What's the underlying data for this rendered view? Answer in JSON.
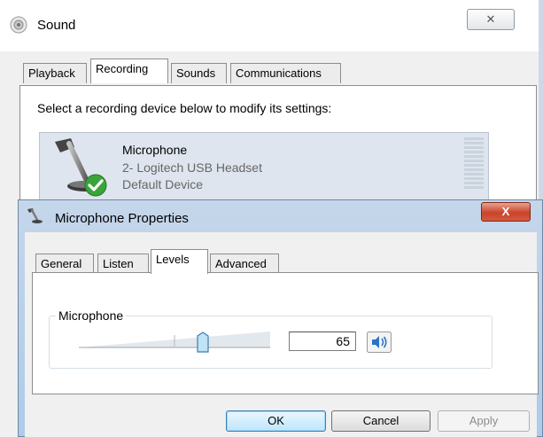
{
  "sound_window": {
    "title": "Sound",
    "close_glyph": "✕",
    "tabs": [
      {
        "label": "Playback"
      },
      {
        "label": "Recording"
      },
      {
        "label": "Sounds"
      },
      {
        "label": "Communications"
      }
    ],
    "active_tab": "Recording",
    "instruction": "Select a recording device below to modify its settings:",
    "device": {
      "name": "Microphone",
      "description": "2- Logitech USB Headset",
      "status": "Default Device"
    }
  },
  "properties_dialog": {
    "title": "Microphone Properties",
    "close_glyph": "X",
    "tabs": [
      {
        "label": "General"
      },
      {
        "label": "Listen"
      },
      {
        "label": "Levels"
      },
      {
        "label": "Advanced"
      }
    ],
    "active_tab": "Levels",
    "level_group_label": "Microphone",
    "level_value": "65",
    "level_percent": 65,
    "buttons": {
      "ok": "OK",
      "cancel": "Cancel",
      "apply": "Apply"
    }
  },
  "icons": {
    "sound_title": "speaker-icon",
    "microphone": "microphone-icon",
    "default_check": "checkmark-icon",
    "props_title": "microphone-icon",
    "mute": "speaker-icon"
  },
  "colors": {
    "accent_check": "#3aa43a",
    "close_red": "#c9442a",
    "ok_border": "#3c7fb1"
  }
}
